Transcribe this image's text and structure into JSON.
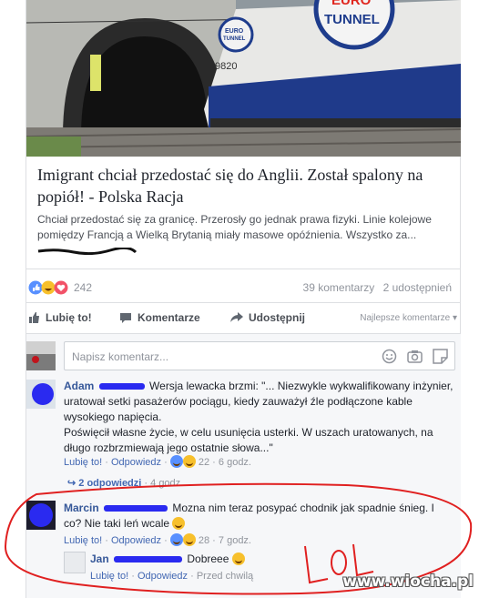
{
  "article": {
    "headline": "Imigrant chciał przedostać się do Anglii. Został spalony na popiół! - Polska Racja",
    "lead": "Chciał przedostać się za granicę. Przerosły go jednak prawa fizyki. Linie kolejowe pomiędzy Francją a Wielką Brytanią miały masowe opóźnienia. Wszystko za...",
    "image_text": {
      "brand": "EURO TUNNEL",
      "brand_small": "EURO TUNNEL",
      "loco_number": "9820"
    }
  },
  "stats": {
    "reaction_count": "242",
    "comments": "39 komentarzy",
    "shares": "2 udostępnień"
  },
  "actions": {
    "like": "Lubię to!",
    "comment": "Komentarze",
    "share": "Udostępnij",
    "sort": "Najlepsze komentarze ▾"
  },
  "composer": {
    "placeholder": "Napisz komentarz..."
  },
  "comments": [
    {
      "author": "Adam",
      "text": "Wersja lewacka brzmi: \"... Niezwykle wykwalifikowany inżynier, uratował setki pasażerów pociągu, kiedy zauważył źle podłączone kable wysokiego napięcia.",
      "text2": "Poświęcił własne życie, w celu usunięcia usterki. W uszach uratowanych, na długo rozbrzmiewają jego ostatnie słowa...\"",
      "like": "Lubię to!",
      "reply": "Odpowiedz",
      "reactions": "22",
      "time": "6 godz.",
      "replies_link": "2 odpowiedzi",
      "replies_time": "4 godz."
    },
    {
      "author": "Marcin",
      "text": "Mozna nim teraz posypać chodnik jak spadnie śnieg. I co? Nie taki leń wcale",
      "like": "Lubię to!",
      "reply": "Odpowiedz",
      "reactions": "28",
      "time": "7 godz."
    },
    {
      "author": "Jan",
      "text": "Dobreee",
      "like": "Lubię to!",
      "reply": "Odpowiedz",
      "time": "Przed chwilą"
    }
  ],
  "annotation": {
    "scribble": "LoL"
  },
  "watermark": "www.wiocha.pl",
  "colors": {
    "link": "#365899",
    "meta": "#90949c",
    "annotation": "#e02020",
    "redaction": "#2a2af0"
  }
}
